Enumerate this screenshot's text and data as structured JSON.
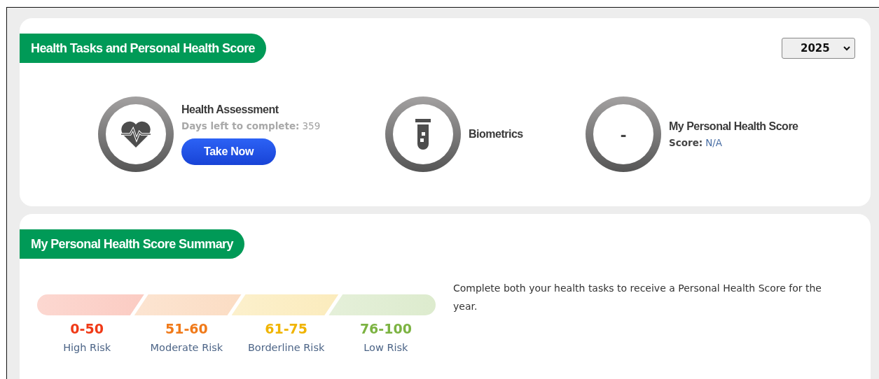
{
  "tasks_card": {
    "title": "Health Tasks and Personal Health Score",
    "year_select": {
      "value": "2025"
    },
    "tasks": [
      {
        "kind": "assessment",
        "title": "Health Assessment",
        "detail_label": "Days left to complete:",
        "detail_value": "359",
        "button": "Take Now"
      },
      {
        "kind": "biometrics",
        "title": "Biometrics"
      },
      {
        "kind": "score",
        "ring_text": "-",
        "title": "My Personal Health Score",
        "detail_label": "Score:",
        "detail_value": "N/A"
      }
    ]
  },
  "summary_card": {
    "title": "My Personal Health Score Summary",
    "bands": [
      {
        "range": "0-50",
        "label": "High Risk",
        "color": "#f03a17"
      },
      {
        "range": "51-60",
        "label": "Moderate Risk",
        "color": "#f07a1a"
      },
      {
        "range": "61-75",
        "label": "Borderline Risk",
        "color": "#f0b400"
      },
      {
        "range": "76-100",
        "label": "Low Risk",
        "color": "#7cb342"
      }
    ],
    "message": "Complete both your health tasks to receive a Personal Health Score for the year."
  }
}
